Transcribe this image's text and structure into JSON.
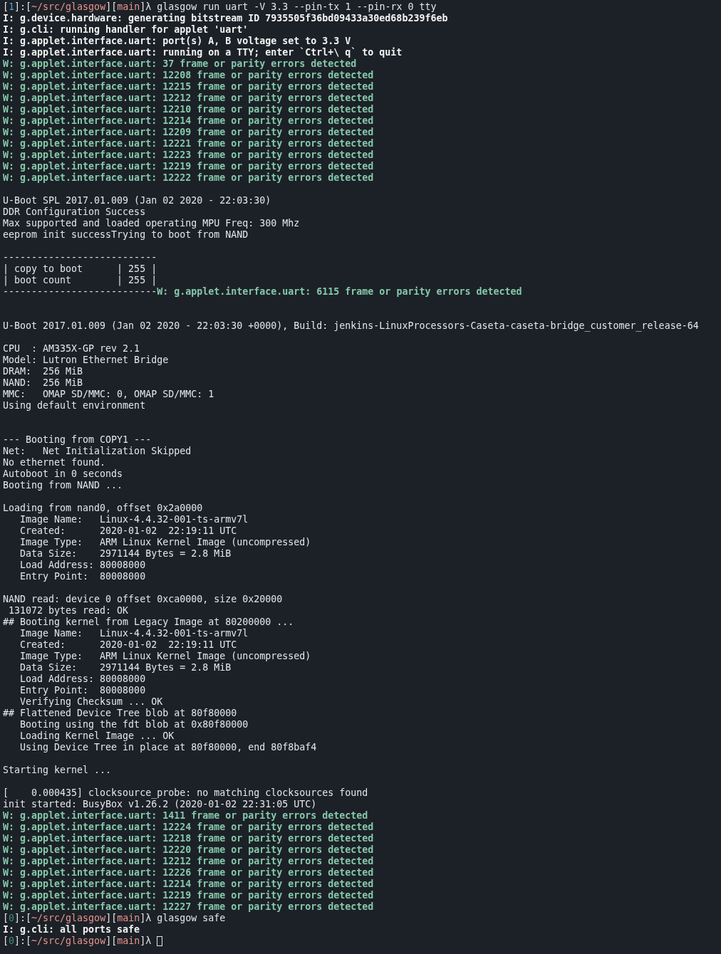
{
  "lines": [
    {
      "kind": "prompt",
      "cursor": false,
      "segments": [
        {
          "kind": "plain",
          "text": "["
        },
        {
          "kind": "status",
          "text": "1",
          "color": "#4f9fd6"
        },
        {
          "kind": "plain",
          "text": "]:["
        },
        {
          "kind": "accent",
          "text": "~/src/glasgow"
        },
        {
          "kind": "plain",
          "text": "]["
        },
        {
          "kind": "accent",
          "text": "main"
        },
        {
          "kind": "plain",
          "text": "]λ glasgow run uart -V 3.3 --pin-tx 1 --pin-rx 0 tty"
        }
      ]
    },
    {
      "kind": "info",
      "text": "I: g.device.hardware: generating bitstream ID 7935505f36bd09433a30ed68b239f6eb"
    },
    {
      "kind": "info",
      "text": "I: g.cli: running handler for applet 'uart'"
    },
    {
      "kind": "info",
      "text": "I: g.applet.interface.uart: port(s) A, B voltage set to 3.3 V"
    },
    {
      "kind": "info",
      "text": "I: g.applet.interface.uart: running on a TTY; enter `Ctrl+\\ q` to quit"
    },
    {
      "kind": "warn",
      "text": "W: g.applet.interface.uart: 37 frame or parity errors detected"
    },
    {
      "kind": "warn",
      "text": "W: g.applet.interface.uart: 12208 frame or parity errors detected"
    },
    {
      "kind": "warn",
      "text": "W: g.applet.interface.uart: 12215 frame or parity errors detected"
    },
    {
      "kind": "warn",
      "text": "W: g.applet.interface.uart: 12212 frame or parity errors detected"
    },
    {
      "kind": "warn",
      "text": "W: g.applet.interface.uart: 12210 frame or parity errors detected"
    },
    {
      "kind": "warn",
      "text": "W: g.applet.interface.uart: 12214 frame or parity errors detected"
    },
    {
      "kind": "warn",
      "text": "W: g.applet.interface.uart: 12209 frame or parity errors detected"
    },
    {
      "kind": "warn",
      "text": "W: g.applet.interface.uart: 12221 frame or parity errors detected"
    },
    {
      "kind": "warn",
      "text": "W: g.applet.interface.uart: 12223 frame or parity errors detected"
    },
    {
      "kind": "warn",
      "text": "W: g.applet.interface.uart: 12219 frame or parity errors detected"
    },
    {
      "kind": "warn",
      "text": "W: g.applet.interface.uart: 12222 frame or parity errors detected"
    },
    {
      "kind": "blank"
    },
    {
      "kind": "plain",
      "text": "U-Boot SPL 2017.01.009 (Jan 02 2020 - 22:03:30)"
    },
    {
      "kind": "plain",
      "text": "DDR Configuration Success"
    },
    {
      "kind": "plain",
      "text": "Max supported and loaded operating MPU Freq: 300 Mhz"
    },
    {
      "kind": "plain",
      "text": "eeprom init successTrying to boot from NAND"
    },
    {
      "kind": "blank"
    },
    {
      "kind": "plain",
      "text": "---------------------------"
    },
    {
      "kind": "plain",
      "text": "| copy to boot      | 255 |"
    },
    {
      "kind": "plain",
      "text": "| boot count        | 255 |"
    },
    {
      "kind": "mixed",
      "segments": [
        {
          "kind": "plain",
          "text": "---------------------------"
        },
        {
          "kind": "warn",
          "text": "W: g.applet.interface.uart: 6115 frame or parity errors detected"
        }
      ]
    },
    {
      "kind": "blank"
    },
    {
      "kind": "blank"
    },
    {
      "kind": "plain",
      "text": "U-Boot 2017.01.009 (Jan 02 2020 - 22:03:30 +0000), Build: jenkins-LinuxProcessors-Caseta-caseta-bridge_customer_release-64"
    },
    {
      "kind": "blank"
    },
    {
      "kind": "plain",
      "text": "CPU  : AM335X-GP rev 2.1"
    },
    {
      "kind": "plain",
      "text": "Model: Lutron Ethernet Bridge"
    },
    {
      "kind": "plain",
      "text": "DRAM:  256 MiB"
    },
    {
      "kind": "plain",
      "text": "NAND:  256 MiB"
    },
    {
      "kind": "plain",
      "text": "MMC:   OMAP SD/MMC: 0, OMAP SD/MMC: 1"
    },
    {
      "kind": "plain",
      "text": "Using default environment"
    },
    {
      "kind": "blank"
    },
    {
      "kind": "blank"
    },
    {
      "kind": "plain",
      "text": "--- Booting from COPY1 ---"
    },
    {
      "kind": "plain",
      "text": "Net:   Net Initialization Skipped"
    },
    {
      "kind": "plain",
      "text": "No ethernet found."
    },
    {
      "kind": "plain",
      "text": "Autoboot in 0 seconds"
    },
    {
      "kind": "plain",
      "text": "Booting from NAND ..."
    },
    {
      "kind": "blank"
    },
    {
      "kind": "plain",
      "text": "Loading from nand0, offset 0x2a0000"
    },
    {
      "kind": "plain",
      "text": "   Image Name:   Linux-4.4.32-001-ts-armv7l"
    },
    {
      "kind": "plain",
      "text": "   Created:      2020-01-02  22:19:11 UTC"
    },
    {
      "kind": "plain",
      "text": "   Image Type:   ARM Linux Kernel Image (uncompressed)"
    },
    {
      "kind": "plain",
      "text": "   Data Size:    2971144 Bytes = 2.8 MiB"
    },
    {
      "kind": "plain",
      "text": "   Load Address: 80008000"
    },
    {
      "kind": "plain",
      "text": "   Entry Point:  80008000"
    },
    {
      "kind": "blank"
    },
    {
      "kind": "plain",
      "text": "NAND read: device 0 offset 0xca0000, size 0x20000"
    },
    {
      "kind": "plain",
      "text": " 131072 bytes read: OK"
    },
    {
      "kind": "plain",
      "text": "## Booting kernel from Legacy Image at 80200000 ..."
    },
    {
      "kind": "plain",
      "text": "   Image Name:   Linux-4.4.32-001-ts-armv7l"
    },
    {
      "kind": "plain",
      "text": "   Created:      2020-01-02  22:19:11 UTC"
    },
    {
      "kind": "plain",
      "text": "   Image Type:   ARM Linux Kernel Image (uncompressed)"
    },
    {
      "kind": "plain",
      "text": "   Data Size:    2971144 Bytes = 2.8 MiB"
    },
    {
      "kind": "plain",
      "text": "   Load Address: 80008000"
    },
    {
      "kind": "plain",
      "text": "   Entry Point:  80008000"
    },
    {
      "kind": "plain",
      "text": "   Verifying Checksum ... OK"
    },
    {
      "kind": "plain",
      "text": "## Flattened Device Tree blob at 80f80000"
    },
    {
      "kind": "plain",
      "text": "   Booting using the fdt blob at 0x80f80000"
    },
    {
      "kind": "plain",
      "text": "   Loading Kernel Image ... OK"
    },
    {
      "kind": "plain",
      "text": "   Using Device Tree in place at 80f80000, end 80f8baf4"
    },
    {
      "kind": "blank"
    },
    {
      "kind": "plain",
      "text": "Starting kernel ..."
    },
    {
      "kind": "blank"
    },
    {
      "kind": "plain",
      "text": "[    0.000435] clocksource_probe: no matching clocksources found"
    },
    {
      "kind": "plain",
      "text": "init started: BusyBox v1.26.2 (2020-01-02 22:31:05 UTC)"
    },
    {
      "kind": "warn",
      "text": "W: g.applet.interface.uart: 1411 frame or parity errors detected"
    },
    {
      "kind": "warn",
      "text": "W: g.applet.interface.uart: 12224 frame or parity errors detected"
    },
    {
      "kind": "warn",
      "text": "W: g.applet.interface.uart: 12218 frame or parity errors detected"
    },
    {
      "kind": "warn",
      "text": "W: g.applet.interface.uart: 12220 frame or parity errors detected"
    },
    {
      "kind": "warn",
      "text": "W: g.applet.interface.uart: 12212 frame or parity errors detected"
    },
    {
      "kind": "warn",
      "text": "W: g.applet.interface.uart: 12226 frame or parity errors detected"
    },
    {
      "kind": "warn",
      "text": "W: g.applet.interface.uart: 12214 frame or parity errors detected"
    },
    {
      "kind": "warn",
      "text": "W: g.applet.interface.uart: 12219 frame or parity errors detected"
    },
    {
      "kind": "warn",
      "text": "W: g.applet.interface.uart: 12227 frame or parity errors detected"
    },
    {
      "kind": "prompt",
      "cursor": false,
      "segments": [
        {
          "kind": "plain",
          "text": "["
        },
        {
          "kind": "status",
          "text": "0",
          "color": "#3f8a80"
        },
        {
          "kind": "plain",
          "text": "]:["
        },
        {
          "kind": "accent",
          "text": "~/src/glasgow"
        },
        {
          "kind": "plain",
          "text": "]["
        },
        {
          "kind": "accent",
          "text": "main"
        },
        {
          "kind": "plain",
          "text": "]λ glasgow safe"
        }
      ]
    },
    {
      "kind": "info",
      "text": "I: g.cli: all ports safe"
    },
    {
      "kind": "prompt",
      "cursor": true,
      "segments": [
        {
          "kind": "plain",
          "text": "["
        },
        {
          "kind": "status",
          "text": "0",
          "color": "#3f8a80"
        },
        {
          "kind": "plain",
          "text": "]:["
        },
        {
          "kind": "accent",
          "text": "~/src/glasgow"
        },
        {
          "kind": "plain",
          "text": "]["
        },
        {
          "kind": "accent",
          "text": "main"
        },
        {
          "kind": "plain",
          "text": "]λ"
        }
      ]
    }
  ]
}
